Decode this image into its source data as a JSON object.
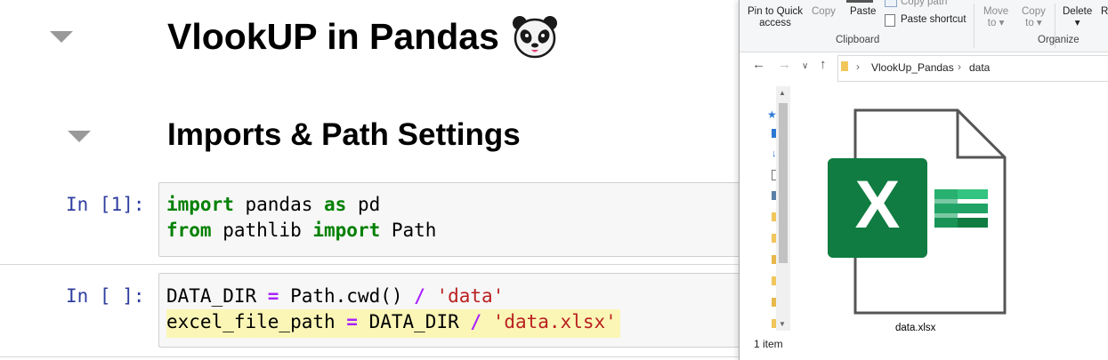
{
  "notebook": {
    "title": "VlookUP in Pandas",
    "section_heading": "Imports & Path Settings",
    "cells": [
      {
        "prompt": "In [1]:"
      },
      {
        "prompt": "In [ ]:"
      }
    ],
    "code": {
      "c1_l1": {
        "kw1": "import",
        "mod": " pandas ",
        "kw2": "as",
        "alias": " pd"
      },
      "c1_l2": {
        "kw1": "from",
        "mod": " pathlib ",
        "kw2": "import",
        "name": " Path"
      },
      "c2_l1": {
        "var": "DATA_DIR ",
        "eq": "=",
        "call": " Path.cwd() ",
        "div": "/",
        "sp": " ",
        "str": "'data'"
      },
      "c2_l2": {
        "var": "excel_file_path ",
        "eq": "=",
        "mid": " DATA_DIR ",
        "div": "/",
        "sp": " ",
        "str": "'data.xlsx'"
      }
    }
  },
  "explorer": {
    "ribbon": {
      "pin_label_line1": "Pin to Quick",
      "pin_label_line2": "access",
      "copy_label": "Copy",
      "paste_label": "Paste",
      "copy_path_label": "Copy path",
      "paste_shortcut_label": "Paste shortcut",
      "move_to_label_line1": "Move",
      "move_to_label_line2": "to",
      "copy_to_label_line1": "Copy",
      "copy_to_label_line2": "to",
      "delete_label": "Delete",
      "rename_label": "Re",
      "clipboard_group": "Clipboard",
      "organize_group": "Organize"
    },
    "breadcrumb": [
      "VlookUp_Pandas",
      "data"
    ],
    "file": {
      "name": "data.xlsx",
      "icon": "excel-file-icon"
    },
    "status": "1 item",
    "colors": {
      "excel_green": "#107c41",
      "excel_light": "#33c481",
      "excel_mid": "#21a366",
      "excel_dark": "#185c37"
    }
  }
}
